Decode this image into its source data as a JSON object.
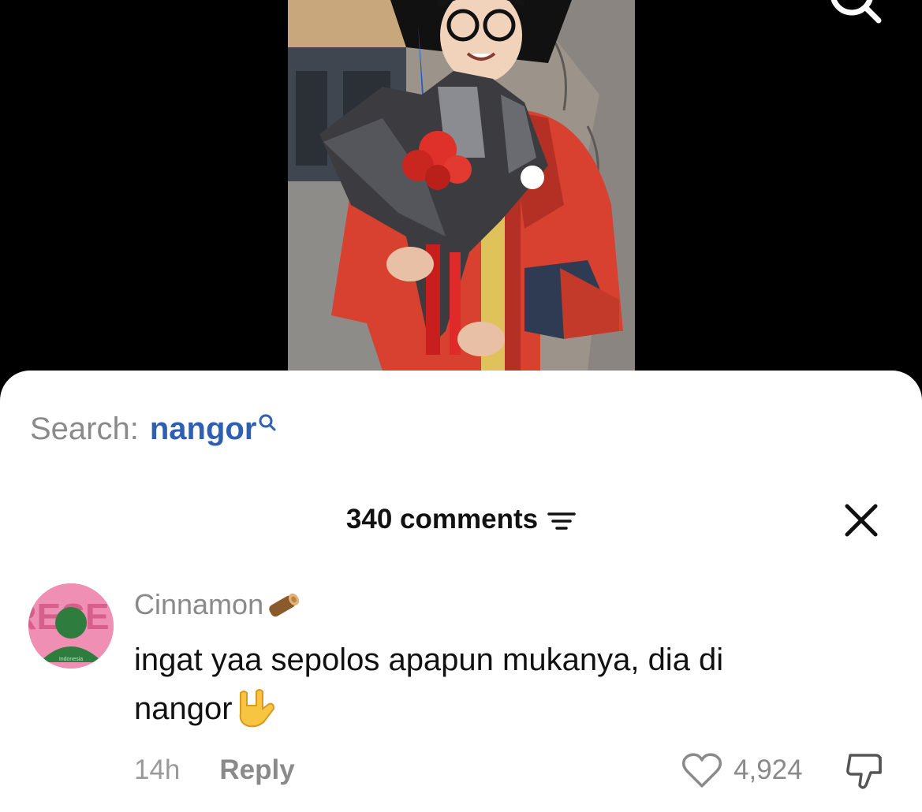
{
  "search": {
    "label": "Search:",
    "term": "nangor"
  },
  "comments_panel": {
    "count_label": "340 comments"
  },
  "comment": {
    "username": "Cinnamon",
    "username_emoji": "wood-log-emoji",
    "text_line1": "ingat yaa sepolos apapun mukanya, dia di",
    "text_line2": "nangor",
    "text_emoji": "rock-on-hand-emoji",
    "time": "14h",
    "reply_label": "Reply",
    "like_count": "4,924",
    "avatar_text": "RESET",
    "avatar_subtext": "Indonesia"
  },
  "colors": {
    "search_term": "#2f5fb3",
    "gown_red": "#d8402f",
    "roses": "#e0302a",
    "avatar_bg": "#f08fb4",
    "avatar_green": "#2e7d3e"
  },
  "icons": [
    "search-icon",
    "search-small-icon",
    "filter-icon",
    "close-icon",
    "heart-icon",
    "dislike-icon"
  ]
}
